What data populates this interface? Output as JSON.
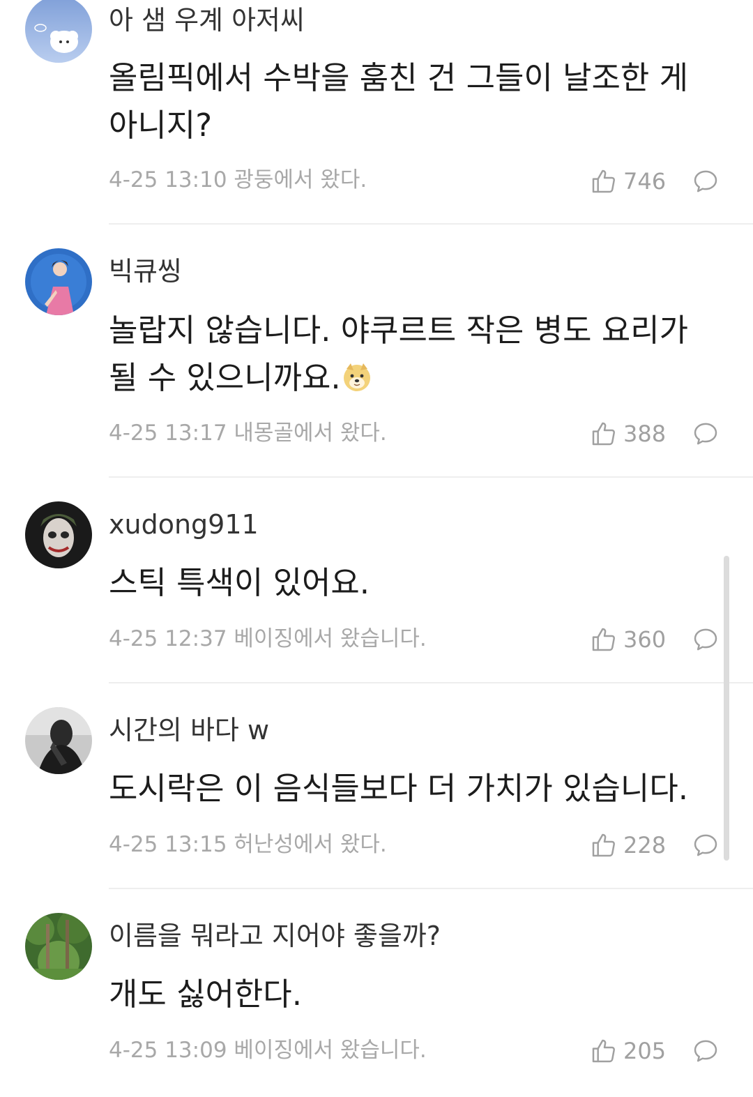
{
  "comments": [
    {
      "username": "아 샘 우계 아저씨",
      "text": "올림픽에서 수박을 훔친 건 그들이 날조한 게 아니지?",
      "meta": "4-25 13:10 광둥에서 왔다.",
      "likes": "746",
      "avatar_icon": "cartoon-sheep-avatar"
    },
    {
      "username": "빅큐씽",
      "text": "놀랍지 않습니다. 야쿠르트 작은 병도 요리가 될 수 있으니까요.",
      "emoji": "doge-emoji",
      "meta": "4-25 13:17 내몽골에서 왔다.",
      "likes": "388",
      "avatar_icon": "anime-girl-avatar"
    },
    {
      "username": "xudong911",
      "text": "스틱 특색이 있어요.",
      "meta": "4-25 12:37 베이징에서 왔습니다.",
      "likes": "360",
      "avatar_icon": "joker-avatar"
    },
    {
      "username": "시간의 바다 w",
      "text": "도시락은 이 음식들보다 더 가치가 있습니다.",
      "meta": "4-25 13:15 허난성에서 왔다.",
      "likes": "228",
      "avatar_icon": "dark-figure-avatar"
    },
    {
      "username": "이름을 뭐라고 지어야 좋을까?",
      "text": "개도 싫어한다.",
      "meta": "4-25 13:09 베이징에서 왔습니다.",
      "likes": "205",
      "avatar_icon": "forest-avatar"
    }
  ]
}
